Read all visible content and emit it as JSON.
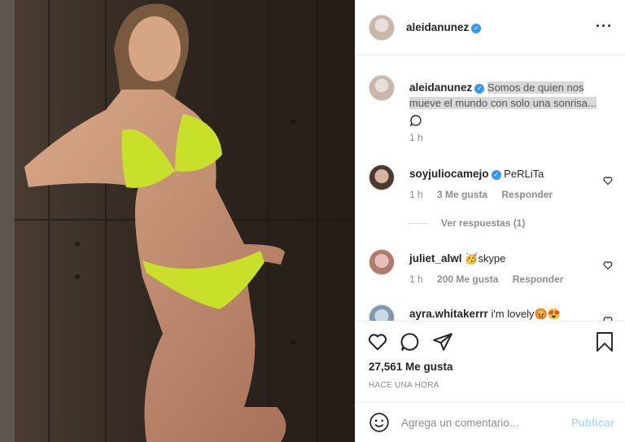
{
  "post": {
    "username": "aleidanunez",
    "verified": true,
    "more_icon": "more-horizontal-icon",
    "caption": "Somos de quien nos mueve el mundo con solo una sonrisa...",
    "caption_time": "1 h"
  },
  "comments": [
    {
      "username": "soyjuliocamejo",
      "verified": true,
      "text": "PeRLiTa",
      "time": "1 h",
      "likes": "3 Me gusta",
      "reply": "Responder",
      "view_replies": "Ver respuestas (1)"
    },
    {
      "username": "juliet_alwl",
      "verified": false,
      "text": "🥳skype",
      "time": "1 h",
      "likes": "200 Me gusta",
      "reply": "Responder"
    },
    {
      "username": "ayra.whitakerrr",
      "verified": false,
      "text": "i'm lovely😡😍"
    }
  ],
  "actions": {
    "likes": "27,561 Me gusta",
    "timestamp": "HACE UNA HORA"
  },
  "comment_box": {
    "placeholder": "Agrega un comentario...",
    "publish": "Publicar"
  },
  "colors": {
    "verified": "#3897f0",
    "publish": "#b3dbff",
    "muted": "#8e8e8e"
  }
}
